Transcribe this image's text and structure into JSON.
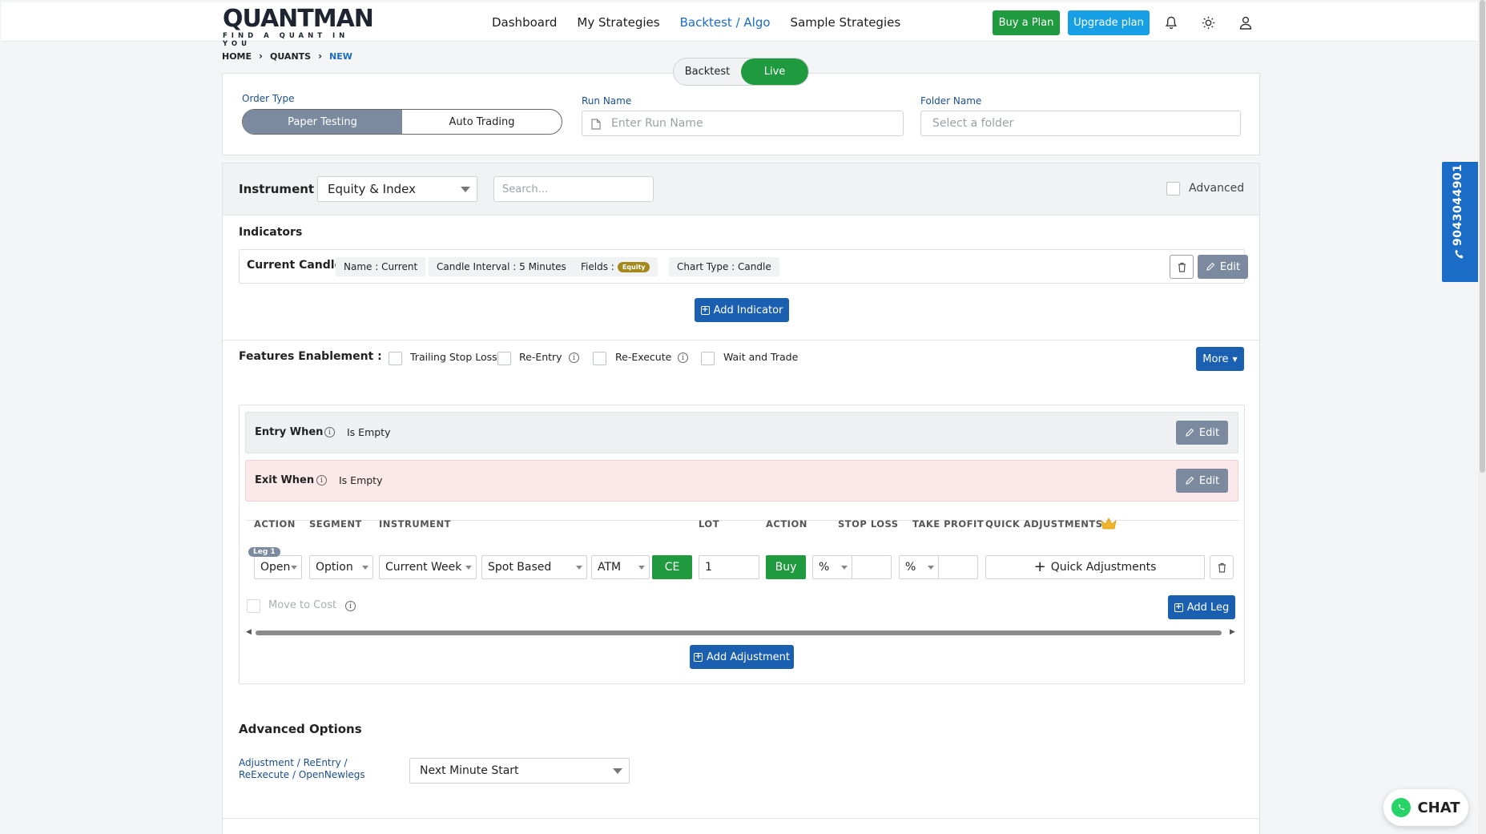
{
  "brand": {
    "name": "QUANTMAN",
    "tagline": "FIND A QUANT IN YOU"
  },
  "nav": {
    "links": [
      "Dashboard",
      "My Strategies",
      "Backtest / Algo",
      "Sample Strategies"
    ],
    "active": "Backtest / Algo",
    "buy_label": "Buy a Plan",
    "upgrade_label": "Upgrade plan",
    "icons": [
      "bell-icon",
      "sun-icon",
      "user-icon"
    ]
  },
  "breadcrumb": [
    "HOME",
    "QUANTS",
    "NEW"
  ],
  "mode_toggle": {
    "options": [
      "Backtest",
      "Live"
    ],
    "selected": "Live"
  },
  "order": {
    "order_type_label": "Order Type",
    "options": [
      "Paper Testing",
      "Auto Trading"
    ],
    "selected": "Paper Testing",
    "run_name_label": "Run Name",
    "run_name_placeholder": "Enter Run Name",
    "folder_label": "Folder Name",
    "folder_placeholder": "Select a folder"
  },
  "instrument": {
    "label": "Instrument",
    "selected": "Equity & Index",
    "search_placeholder": "Search...",
    "advanced_label": "Advanced"
  },
  "indicators": {
    "title": "Indicators",
    "row": {
      "name": "Current Candle",
      "chips": [
        "Name : Current",
        "Candle Interval : 5 Minutes",
        "Fields :",
        "Chart Type : Candle"
      ],
      "fields_badge": "Equity"
    },
    "edit_label": "Edit",
    "add_label": "Add Indicator"
  },
  "features": {
    "label": "Features Enablement :",
    "items": [
      "Trailing Stop Loss",
      "Re-Entry",
      "Re-Execute",
      "Wait and Trade"
    ],
    "more_label": "More"
  },
  "conditions": {
    "entry": {
      "label": "Entry When",
      "value": "Is Empty",
      "edit": "Edit"
    },
    "exit": {
      "label": "Exit When",
      "value": "Is Empty",
      "edit": "Edit"
    }
  },
  "leg_table": {
    "headers": [
      "ACTION",
      "SEGMENT",
      "INSTRUMENT",
      "LOT",
      "ACTION",
      "STOP LOSS",
      "TAKE PROFIT",
      "QUICK ADJUSTMENTS"
    ],
    "leg": {
      "badge": "Leg 1",
      "action": "Open",
      "segment": "Option",
      "expiry": "Current Week",
      "strike_type": "Spot Based",
      "strike": "ATM",
      "option_type": "CE",
      "lot": "1",
      "side": "Buy",
      "stop_loss_unit": "%",
      "take_profit_unit": "%",
      "quick_adjustments": "Quick Adjustments"
    },
    "move_to_cost": "Move to Cost",
    "add_leg": "Add Leg",
    "add_adjustment": "Add Adjustment"
  },
  "advanced_options": {
    "title": "Advanced Options",
    "row_label_1": "Adjustment / ReEntry /",
    "row_label_2": "ReExecute / OpenNewlegs",
    "selected": "Next Minute Start"
  },
  "side_phone": "9043044901",
  "chat_label": "CHAT",
  "colors": {
    "primary": "#1b5fb0",
    "success": "#1f9a3e",
    "accent": "#18a0e6",
    "muted": "#7c8aa0"
  }
}
